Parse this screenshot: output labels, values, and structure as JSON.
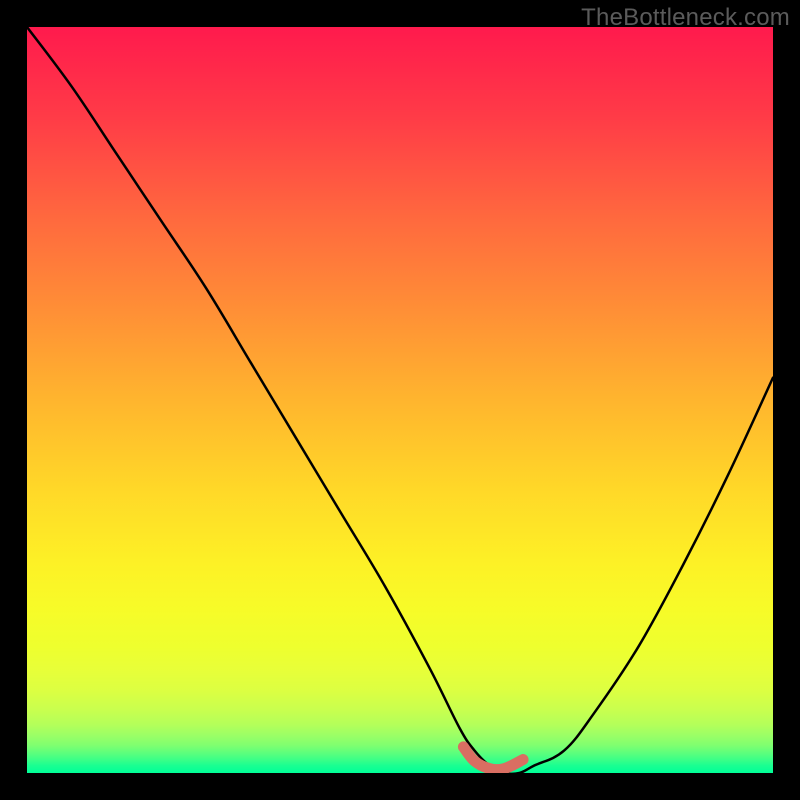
{
  "watermark": "TheBottleneck.com",
  "chart_data": {
    "type": "line",
    "title": "",
    "xlabel": "",
    "ylabel": "",
    "xlim": [
      0,
      100
    ],
    "ylim": [
      0,
      100
    ],
    "series": [
      {
        "name": "bottleneck-curve",
        "x": [
          0,
          6,
          12,
          18,
          24,
          30,
          36,
          42,
          48,
          54,
          58,
          60,
          62,
          64,
          66,
          68,
          72,
          76,
          82,
          88,
          94,
          100
        ],
        "values": [
          100,
          92,
          83,
          74,
          65,
          55,
          45,
          35,
          25,
          14,
          6,
          3,
          1,
          0,
          0,
          1,
          3,
          8,
          17,
          28,
          40,
          53
        ]
      }
    ],
    "accent_segment": {
      "x": [
        58.5,
        60,
        62,
        64,
        66.5
      ],
      "values": [
        3.5,
        1.6,
        0.6,
        0.6,
        1.8
      ],
      "color": "#d96e62"
    },
    "gradient_colors": {
      "top": "#ff1a4d",
      "mid": "#ffd828",
      "bottom": "#00ff98"
    }
  }
}
